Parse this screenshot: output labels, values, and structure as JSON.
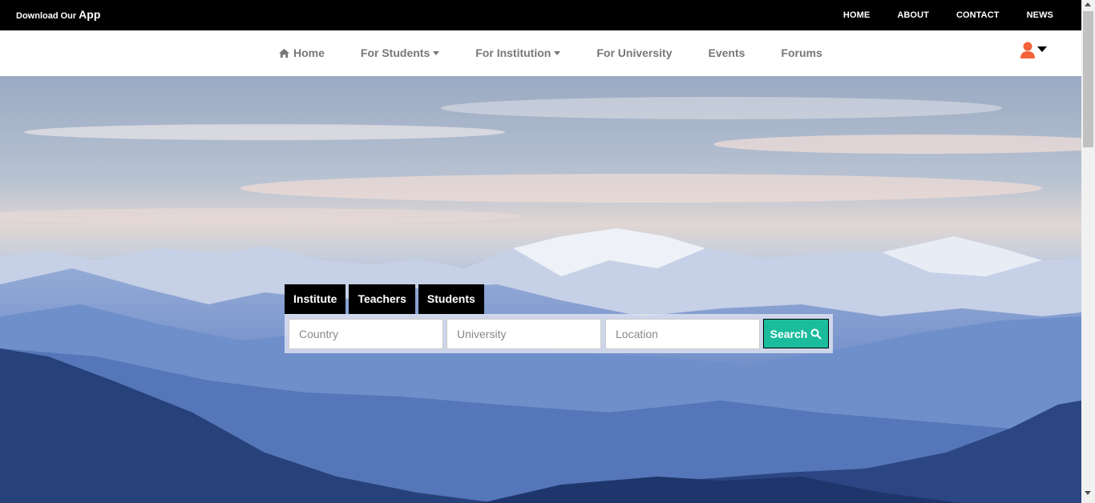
{
  "topbar": {
    "download_text": "Download Our",
    "app_text": "App",
    "links": [
      "HOME",
      "ABOUT",
      "CONTACT",
      "NEWS"
    ]
  },
  "nav": {
    "home": "Home",
    "students": "For Students",
    "institution": "For Institution",
    "university": "For University",
    "events": "Events",
    "forums": "Forums"
  },
  "search": {
    "tabs": [
      "Institute",
      "Teachers",
      "Students"
    ],
    "country_placeholder": "Country",
    "university_placeholder": "University",
    "location_placeholder": "Location",
    "button_label": "Search"
  },
  "colors": {
    "accent": "#1abc9c",
    "user_icon": "#f4623a",
    "topbar": "#000000"
  },
  "icons": {
    "home": "home-icon",
    "user": "user-icon",
    "search": "search-icon",
    "caret": "caret-down-icon"
  }
}
